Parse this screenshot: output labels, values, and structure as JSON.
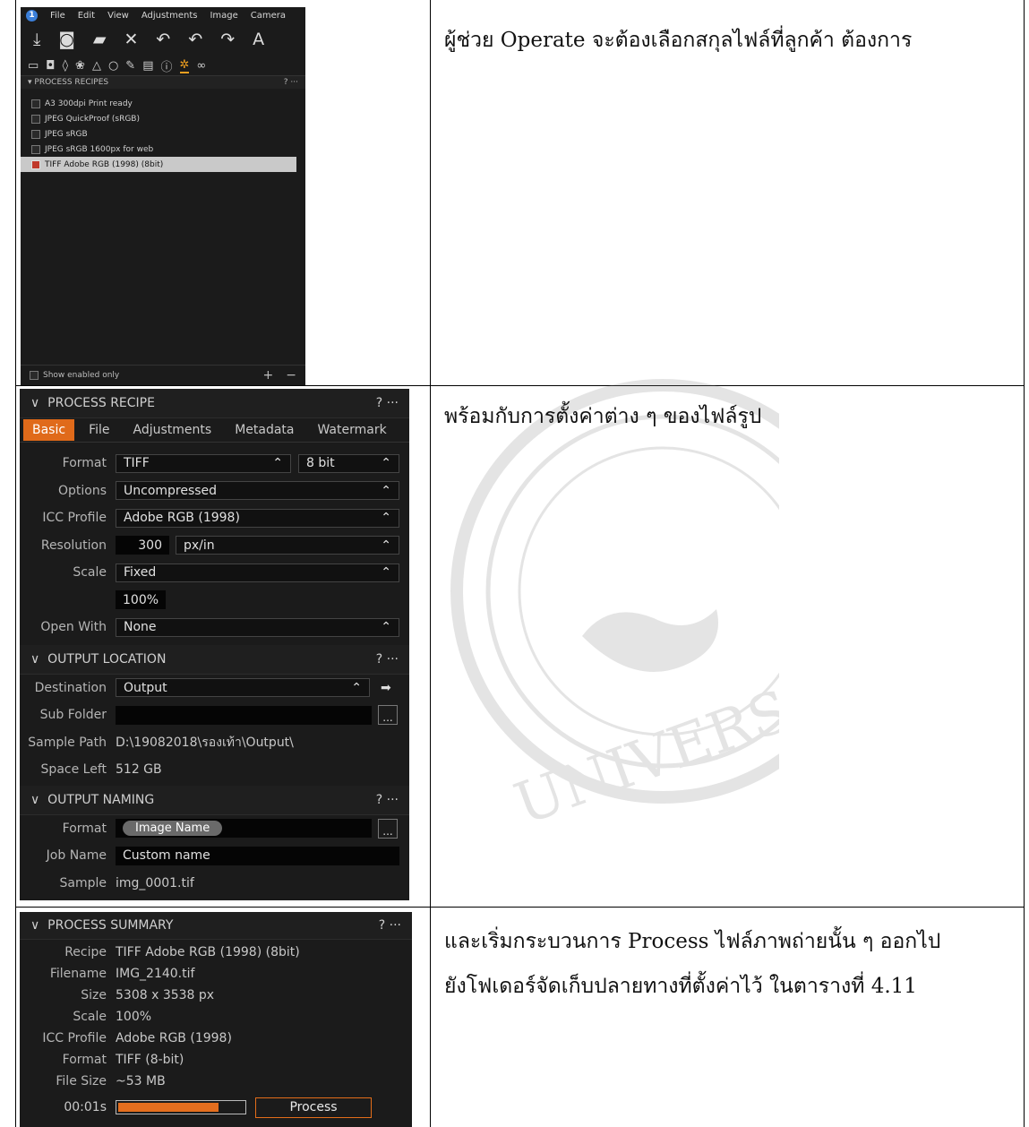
{
  "panel1": {
    "menu": [
      "File",
      "Edit",
      "View",
      "Adjustments",
      "Image",
      "Camera"
    ],
    "section_title": "PROCESS RECIPES",
    "help": "?",
    "more": "···",
    "recipes": [
      {
        "label": "A3 300dpi Print ready",
        "checked": false
      },
      {
        "label": "JPEG QuickProof (sRGB)",
        "checked": false
      },
      {
        "label": "JPEG sRGB",
        "checked": false
      },
      {
        "label": "JPEG sRGB 1600px for web",
        "checked": false
      },
      {
        "label": "TIFF Adobe RGB (1998) (8bit)",
        "checked": true
      }
    ],
    "show_enabled": "Show enabled only",
    "add": "+",
    "remove": "−"
  },
  "recipe": {
    "title": "PROCESS RECIPE",
    "tabs": [
      "Basic",
      "File",
      "Adjustments",
      "Metadata",
      "Watermark"
    ],
    "format_label": "Format",
    "format": "TIFF",
    "bit": "8 bit",
    "options_label": "Options",
    "options": "Uncompressed",
    "icc_label": "ICC Profile",
    "icc": "Adobe RGB (1998)",
    "res_label": "Resolution",
    "res": "300",
    "res_unit": "px/in",
    "scale_label": "Scale",
    "scale": "Fixed",
    "scale_value": "100%",
    "open_label": "Open With",
    "open": "None"
  },
  "output_location": {
    "title": "OUTPUT LOCATION",
    "dest_label": "Destination",
    "dest": "Output",
    "sub_label": "Sub Folder",
    "sample_label": "Sample Path",
    "sample": "D:\\19082018\\รองเท้า\\Output\\",
    "space_label": "Space Left",
    "space": "512 GB"
  },
  "output_naming": {
    "title": "OUTPUT NAMING",
    "format_label": "Format",
    "format_token": "Image Name",
    "job_label": "Job Name",
    "job": "Custom name",
    "sample_label": "Sample",
    "sample": "img_0001.tif"
  },
  "summary": {
    "title": "PROCESS SUMMARY",
    "rows": [
      {
        "label": "Recipe",
        "value": "TIFF Adobe RGB (1998) (8bit)"
      },
      {
        "label": "Filename",
        "value": "IMG_2140.tif"
      },
      {
        "label": "Size",
        "value": "5308 x 3538 px"
      },
      {
        "label": "Scale",
        "value": "100%"
      },
      {
        "label": "ICC Profile",
        "value": "Adobe RGB (1998)"
      },
      {
        "label": "Format",
        "value": "TIFF (8-bit)"
      },
      {
        "label": "File Size",
        "value": "~53 MB"
      }
    ],
    "time": "00:01s",
    "progress": 0.78,
    "process_label": "Process"
  },
  "text": {
    "row1": "ผู้ช่วย Operate จะต้องเลือกสกุลไฟล์ที่ลูกค้า ต้องการ",
    "row2": "พร้อมกับการตั้งค่าต่าง ๆ ของไฟล์รูป",
    "row3a": "และเริ่มกระบวนการ Process ไฟล์ภาพถ่ายนั้น ๆ ออกไป",
    "row3b": "ยังโฟเดอร์จัดเก็บปลายทางที่ตั้งค่าไว้ ในตารางที่ 4.11"
  },
  "watermark_text": "UNIVERSITY"
}
